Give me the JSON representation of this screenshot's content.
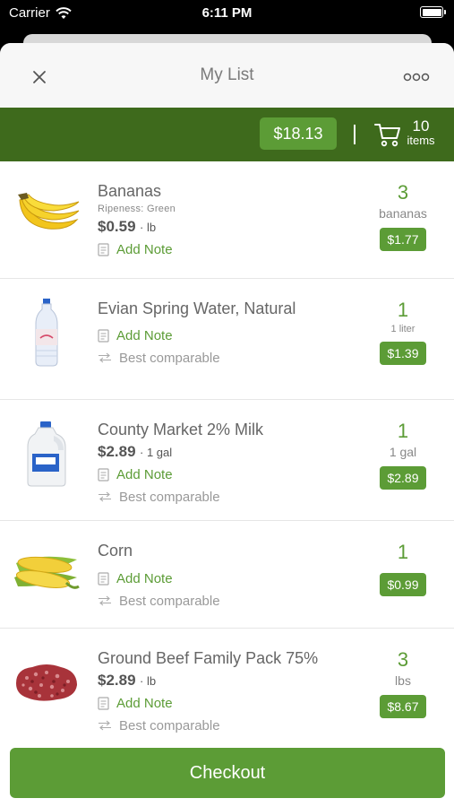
{
  "status_bar": {
    "carrier": "Carrier",
    "time": "6:11 PM"
  },
  "nav": {
    "title": "My List",
    "close_icon": "close-icon",
    "more_icon": "more-icon"
  },
  "summary": {
    "total": "$18.13",
    "item_count": "10",
    "items_label": "items"
  },
  "items": [
    {
      "name": "Bananas",
      "sub": "Ripeness: Green",
      "price": "$0.59",
      "unit": "lb",
      "note": "Add Note",
      "qty": "3",
      "qty_unit": "bananas",
      "line_total": "$1.77"
    },
    {
      "name": "Evian Spring Water, Natural",
      "note": "Add Note",
      "comparable": "Best comparable",
      "qty": "1",
      "qty_unit": "1 liter",
      "line_total": "$1.39"
    },
    {
      "name": "County Market 2% Milk",
      "price": "$2.89",
      "unit": "1 gal",
      "note": "Add Note",
      "comparable": "Best comparable",
      "qty": "1",
      "qty_unit": "1 gal",
      "line_total": "$2.89"
    },
    {
      "name": "Corn",
      "note": "Add Note",
      "comparable": "Best comparable",
      "qty": "1",
      "line_total": "$0.99"
    },
    {
      "name": "Ground Beef Family Pack 75%",
      "price": "$2.89",
      "unit": "lb",
      "note": "Add Note",
      "comparable": "Best comparable",
      "qty": "3",
      "qty_unit": "lbs",
      "line_total": "$8.67"
    }
  ],
  "checkout": {
    "label": "Checkout"
  },
  "colors": {
    "brand_green": "#5c9c36",
    "dark_green": "#3e6a1c"
  }
}
